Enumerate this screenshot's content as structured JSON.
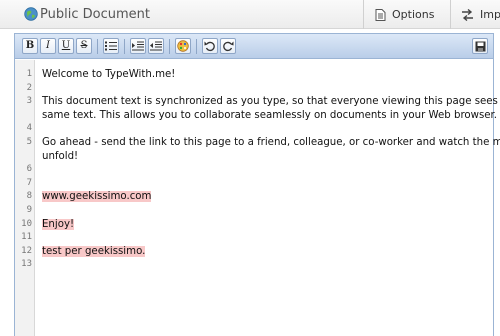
{
  "header": {
    "title": "Public Document",
    "options_label": "Options",
    "import_label": "Impo"
  },
  "toolbar": {
    "bold": "B",
    "italic": "I",
    "underline": "U",
    "strike": "S",
    "buttons": [
      "bold",
      "italic",
      "underline",
      "strikethrough",
      "bulleted-list",
      "indent",
      "outdent",
      "highlight",
      "undo",
      "redo",
      "save"
    ]
  },
  "editor": {
    "line_numbers": [
      "1",
      "2",
      "3",
      "4",
      "5",
      "6",
      "7",
      "8",
      "9",
      "10",
      "11",
      "12",
      "13"
    ],
    "lines": {
      "l1": "Welcome to TypeWith.me!",
      "l3a": "This document text is synchronized as you type, so that everyone viewing this page sees the",
      "l3b": "same text. This allows you to collaborate seamlessly on documents in your Web browser.",
      "l5a": "Go ahead - send the link to this page to a friend, colleague, or co-worker and watch the magic",
      "l5b": "unfold!",
      "l8": "www.geekissimo.com",
      "l10": "Enjoy!",
      "l12": "test per geekissimo."
    },
    "highlight_color": "#f8c8c8"
  }
}
